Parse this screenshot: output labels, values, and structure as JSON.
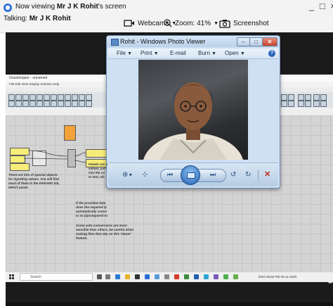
{
  "toolbar": {
    "viewing_prefix": "Now viewing ",
    "viewing_name": "Mr J K Rohit",
    "viewing_suffix": "'s screen",
    "talking_label": "Talking: ",
    "talking_name": "Mr J K Rohit",
    "webcams_label": "Webcams",
    "zoom_label": "Zoom: 41%",
    "screenshot_label": "Screenshot",
    "window_controls": "_ □ ×"
  },
  "photo_viewer": {
    "title": "Rohit - Windows Photo Viewer",
    "menu": [
      "File",
      "Print",
      "E-mail",
      "Burn",
      "Open"
    ],
    "help": "?",
    "controls": {
      "zoom": "⊕",
      "fit": "⊹",
      "prev": "⏮",
      "next": "⏭",
      "rotate_left": "↺",
      "rotate_right": "↻",
      "delete": "✕"
    }
  },
  "background_app": {
    "title": "Grasshopper - unnamed",
    "menu": "File  Edit  View  Display  Solution  Help",
    "notes": [
      "Panels are a\nvalues, just\ninto the co\nto text, wh",
      "If the provided data\ndoes the required ty\nautomatically conve\nis so (a)compared to",
      "Some auto-conversions are more\nsensible than others; be careful when\nmaking files that rely on this 'clever'\nfeature.",
      "There are lots of special objects\nfor inputting values. You will find\nmost of them in the PARAMS tab,\nINPUT panel."
    ]
  },
  "taskbar": {
    "search_placeholder": "Search",
    "tray_text": "ENG  09:50 PM  09-11-2020"
  },
  "colors": {
    "accent": "#2b6fd6",
    "viewer_chrome": "#cfe0f2",
    "close_red": "#c5402a",
    "delete_red": "#c0281b",
    "screen_bg": "#1b1b1b"
  }
}
